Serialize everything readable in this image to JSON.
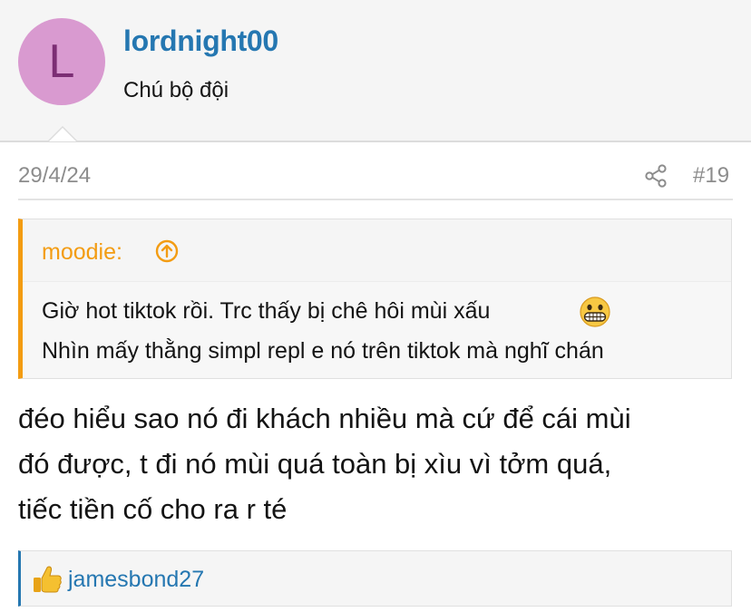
{
  "user": {
    "avatar_letter": "L",
    "name": "lordnight00",
    "title": "Chú bộ đội"
  },
  "post": {
    "date": "29/4/24",
    "number": "#19",
    "message_lines": [
      "đéo hiểu sao nó đi khách nhiều mà cứ để cái mùi",
      "đó được, t đi nó mùi quá toàn bị xìu vì tởm quá,",
      "tiếc tiền cố cho ra r té"
    ]
  },
  "quote": {
    "author": "moodie:",
    "lines": [
      "Giờ hot tiktok rồi. Trc thấy bị chê hôi mùi xấu",
      "Nhìn mấy thằng simpl repl e nó trên tiktok mà nghĩ chán"
    ]
  },
  "reactions": {
    "liked_by": "jamesbond27"
  },
  "colors": {
    "link": "#2577b1",
    "quote_accent": "#f39c12",
    "avatar_bg": "#d99ad0",
    "avatar_fg": "#7c2e74"
  },
  "icons": [
    "share-icon",
    "arrow-up-circle-icon",
    "grimacing-emoji-icon",
    "thumbs-up-icon"
  ]
}
